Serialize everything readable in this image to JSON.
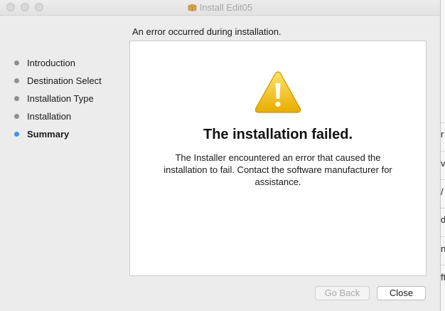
{
  "window": {
    "title": "Install Edit05",
    "heading": "An error occurred during installation."
  },
  "sidebar": {
    "steps": [
      {
        "label": "Introduction",
        "active": false
      },
      {
        "label": "Destination Select",
        "active": false
      },
      {
        "label": "Installation Type",
        "active": false
      },
      {
        "label": "Installation",
        "active": false
      },
      {
        "label": "Summary",
        "active": true
      }
    ]
  },
  "panel": {
    "title": "The installation failed.",
    "message": "The Installer encountered an error that caused the installation to fail. Contact the software manufacturer for assistance."
  },
  "buttons": {
    "back_label": "Go Back",
    "close_label": "Close"
  },
  "background_window": {
    "fragments": [
      "r",
      "v",
      "/",
      "d",
      "n",
      "ft"
    ]
  },
  "colors": {
    "active_step_dot": "#3e94ea",
    "inactive_step_dot": "#8f8f8f",
    "warning_yellow": "#f2c200"
  },
  "icons": {
    "title_icon": "package-icon",
    "panel_icon": "warning-icon"
  }
}
